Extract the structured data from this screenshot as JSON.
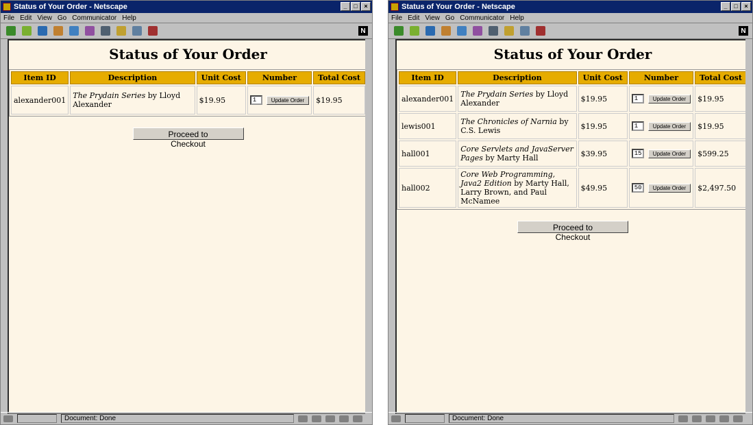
{
  "window_title": "Status of Your Order - Netscape",
  "menu": [
    "File",
    "Edit",
    "View",
    "Go",
    "Communicator",
    "Help"
  ],
  "titlebar_buttons": [
    "_",
    "□",
    "×"
  ],
  "toolbar_icons": [
    "back-icon",
    "forward-icon",
    "reload-icon",
    "home-icon",
    "search-icon",
    "netscape-guide-icon",
    "print-icon",
    "security-icon",
    "shop-icon",
    "stop-icon"
  ],
  "netscape_logo": "N",
  "status_text": "Document: Done",
  "page_title": "Status of Your Order",
  "headers": [
    "Item ID",
    "Description",
    "Unit Cost",
    "Number",
    "Total Cost"
  ],
  "update_label": "Update Order",
  "checkout_label": "Proceed to Checkout",
  "colors": {
    "header_bg": "#e6ac00",
    "page_bg": "#fdf5e6",
    "titlebar": "#0a246a"
  },
  "left_window": {
    "rows": [
      {
        "id": "alexander001",
        "title": "The Prydain Series",
        "rest": " by Lloyd Alexander",
        "unit": "$19.95",
        "qty": "1",
        "total": "$19.95"
      }
    ]
  },
  "right_window": {
    "rows": [
      {
        "id": "alexander001",
        "title": "The Prydain Series",
        "rest": " by Lloyd Alexander",
        "unit": "$19.95",
        "qty": "1",
        "total": "$19.95"
      },
      {
        "id": "lewis001",
        "title": "The Chronicles of Narnia",
        "rest": " by C.S. Lewis",
        "unit": "$19.95",
        "qty": "1",
        "total": "$19.95"
      },
      {
        "id": "hall001",
        "title": "Core Servlets and JavaServer Pages",
        "rest": " by Marty Hall",
        "unit": "$39.95",
        "qty": "15",
        "total": "$599.25"
      },
      {
        "id": "hall002",
        "title": "Core Web Programming, Java2 Edition",
        "rest": " by Marty Hall, Larry Brown, and Paul McNamee",
        "unit": "$49.95",
        "qty": "50",
        "total": "$2,497.50"
      }
    ]
  }
}
